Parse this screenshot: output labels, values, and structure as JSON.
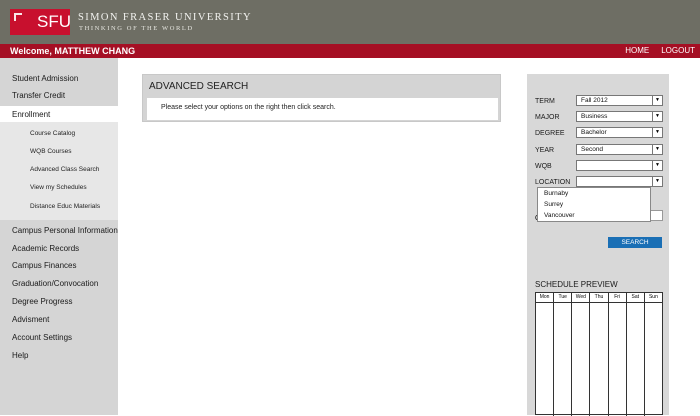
{
  "header": {
    "logo_text": "SFU",
    "university_name": "SIMON FRASER UNIVERSITY",
    "tagline": "THINKING OF THE WORLD"
  },
  "userbar": {
    "welcome": "Welcome, MATTHEW CHANG",
    "home": "HOME",
    "logout": "LOGOUT"
  },
  "sidebar": {
    "items": [
      {
        "label": "Student Admission"
      },
      {
        "label": "Transfer Credit"
      },
      {
        "label": "Enrollment"
      },
      {
        "label": "Campus Personal Information"
      },
      {
        "label": "Academic Records"
      },
      {
        "label": "Campus Finances"
      },
      {
        "label": "Graduation/Convocation"
      },
      {
        "label": "Degree Progress"
      },
      {
        "label": "Advisment"
      },
      {
        "label": "Account Settings"
      },
      {
        "label": "Help"
      }
    ],
    "subitems": [
      {
        "label": "Course Catalog"
      },
      {
        "label": "WQB Courses"
      },
      {
        "label": "Advanced Class Search"
      },
      {
        "label": "View my Schedules"
      },
      {
        "label": "Distance Educ Materials"
      }
    ]
  },
  "search": {
    "title": "ADVANCED SEARCH",
    "message": "Please select your options on the right then click search."
  },
  "filters": {
    "term_label": "TERM",
    "term_value": "Fall 2012",
    "major_label": "MAJOR",
    "major_value": "Business",
    "degree_label": "DEGREE",
    "degree_value": "Bachelor",
    "year_label": "YEAR",
    "year_value": "Second",
    "wqb_label": "WQB",
    "wqb_value": "",
    "location_label": "LOCATION",
    "location_value": "",
    "location_options": [
      "Burnaby",
      "Surrey",
      "Vancouver"
    ],
    "hidden_label_fragment": "C",
    "search_button": "SEARCH"
  },
  "schedule": {
    "title": "SCHEDULE PREVIEW",
    "days": [
      "Mon",
      "Tue",
      "Wed",
      "Thu",
      "Fri",
      "Sat",
      "Sun"
    ]
  },
  "colors": {
    "topbar": "#6e6e64",
    "brand_red": "#c8102e",
    "userbar": "#a50f24",
    "sidebar": "#d5d5d5",
    "button_blue": "#1a6fb5"
  }
}
